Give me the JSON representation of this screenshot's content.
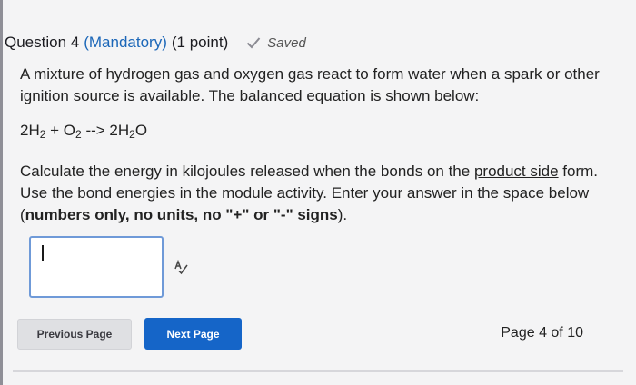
{
  "question": {
    "number_label": "Question 4",
    "mandatory_label": "(Mandatory)",
    "points_label": "(1 point)",
    "saved_label": "Saved"
  },
  "body": {
    "paragraph1": "A mixture of hydrogen gas and oxygen gas react to form water when a spark or other ignition source is available.  The balanced equation is shown below:",
    "equation": {
      "h2_coef": "2H",
      "h2_sub": "2",
      "plus": " + O",
      "o2_sub": "2",
      "arrow": " --> 2H",
      "h2o_sub": "2",
      "o": "O"
    },
    "paragraph2": {
      "part1": "Calculate the energy in kilojoules released when the bonds on the ",
      "underlined": "product side",
      "part2": " form.  Use the bond energies in the module activity.  Enter your answer in the space below (",
      "bold": "numbers only, no units, no \"+\" or \"-\" signs",
      "part3": ")."
    }
  },
  "answer": {
    "value": ""
  },
  "nav": {
    "prev_label": "Previous Page",
    "next_label": "Next Page",
    "page_indicator": "Page 4 of 10"
  },
  "icons": {
    "saved": "check-icon",
    "spell": "spellcheck-icon"
  },
  "colors": {
    "accent": "#1565c8",
    "mandatory": "#1c67b8"
  }
}
